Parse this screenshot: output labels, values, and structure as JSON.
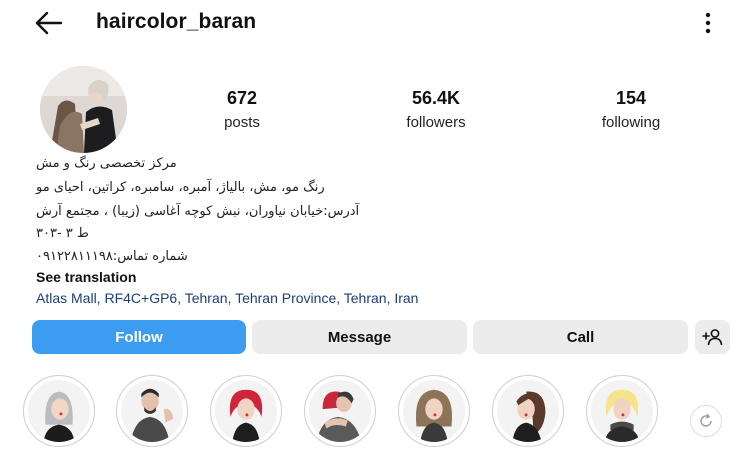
{
  "header": {
    "username": "haircolor_baran",
    "back_icon": "arrow-left-icon",
    "more_icon": "vertical-dots-icon"
  },
  "stats": {
    "posts": {
      "value": "672",
      "label": "posts"
    },
    "followers": {
      "value": "56.4K",
      "label": "followers"
    },
    "following": {
      "value": "154",
      "label": "following"
    }
  },
  "bio": {
    "lines": [
      "مرکز تخصصی رنگ و مش",
      "رنگ مو، مش، بالیاژ، آمبره، سامبره، کراتین، احیای مو",
      "آدرس:خیابان نیاوران، نبش کوچه آغاسی (زیبا) ، مجتمع آرش",
      "ط ۳ -۳۰۳",
      "شماره تماس:۰۹۱۲۲۸۱۱۱۹۸"
    ],
    "see_translation": "See translation",
    "location": "Atlas Mall, RF4C+GP6, Tehran, Tehran Province, Tehran, Iran"
  },
  "actions": {
    "follow": "Follow",
    "message": "Message",
    "call": "Call",
    "add_user_icon": "add-user-icon"
  },
  "colors": {
    "accent": "#3b9cf0",
    "button_bg": "#ececec",
    "link": "#1b3e7a"
  },
  "highlights": [
    {
      "icon": "highlight-avatar-gray-hair"
    },
    {
      "icon": "highlight-avatar-couple"
    },
    {
      "icon": "highlight-avatar-red-hair"
    },
    {
      "icon": "highlight-avatar-red-hug"
    },
    {
      "icon": "highlight-avatar-blonde"
    },
    {
      "icon": "highlight-avatar-brown-hair"
    },
    {
      "icon": "highlight-avatar-platinum"
    }
  ]
}
